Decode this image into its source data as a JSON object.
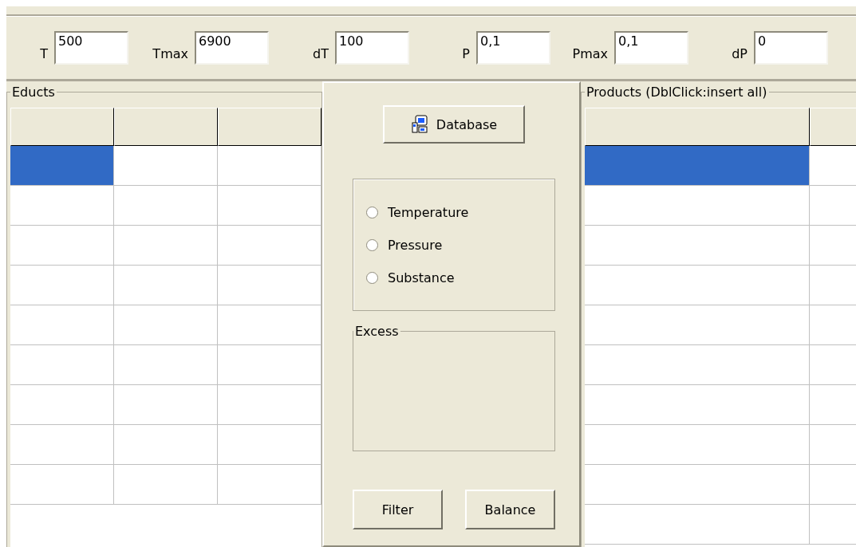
{
  "parameters": [
    {
      "label": "T",
      "value": "500"
    },
    {
      "label": "Tmax",
      "value": "6900"
    },
    {
      "label": "dT",
      "value": "100"
    },
    {
      "label": "P",
      "value": "0,1"
    },
    {
      "label": "Pmax",
      "value": "0,1"
    },
    {
      "label": "dP",
      "value": "0"
    }
  ],
  "educts": {
    "title": "Educts",
    "rows": [
      {
        "selected": true
      },
      {
        "selected": false
      },
      {
        "selected": false
      },
      {
        "selected": false
      },
      {
        "selected": false
      },
      {
        "selected": false
      },
      {
        "selected": false
      },
      {
        "selected": false
      },
      {
        "selected": false
      }
    ]
  },
  "center": {
    "database_button": "Database",
    "mode_options": [
      {
        "label": "Temperature",
        "selected": false
      },
      {
        "label": "Pressure",
        "selected": false
      },
      {
        "label": "Substance",
        "selected": false
      }
    ],
    "excess_group": {
      "title": "Excess"
    },
    "buttons": [
      "Filter",
      "Balance"
    ]
  },
  "products": {
    "title": "Products (DblClick:insert all)",
    "rows": [
      {
        "selected": true
      },
      {
        "selected": false
      },
      {
        "selected": false
      },
      {
        "selected": false
      },
      {
        "selected": false
      },
      {
        "selected": false
      },
      {
        "selected": false
      },
      {
        "selected": false
      },
      {
        "selected": false
      },
      {
        "selected": false
      }
    ]
  }
}
